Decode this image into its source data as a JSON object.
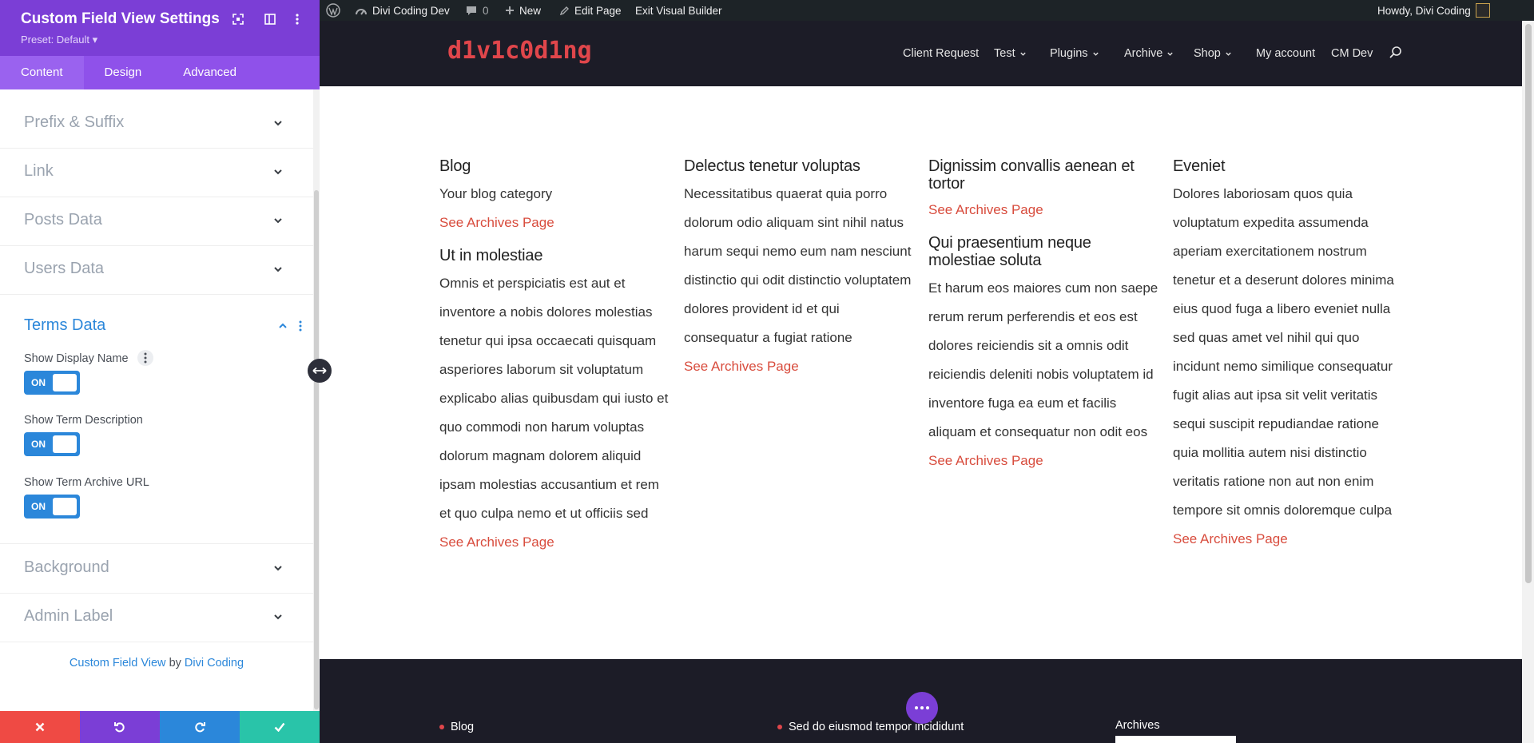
{
  "panel": {
    "title": "Custom Field View Settings",
    "preset": "Preset: Default ▾",
    "tabs": [
      {
        "label": "Content",
        "active": true
      },
      {
        "label": "Design"
      },
      {
        "label": "Advanced"
      }
    ],
    "sections": {
      "prefix_suffix": "Prefix & Suffix",
      "link": "Link",
      "posts_data": "Posts Data",
      "users_data": "Users Data",
      "terms_data": "Terms Data",
      "background": "Background",
      "admin_label": "Admin Label"
    },
    "fields": [
      {
        "label": "Show Display Name",
        "toggle": "ON"
      },
      {
        "label": "Show Term Description",
        "toggle": "ON"
      },
      {
        "label": "Show Term Archive URL",
        "toggle": "ON"
      }
    ],
    "credit": {
      "module": "Custom Field View",
      "by": "by",
      "author": "Divi Coding"
    },
    "footer_colors": {
      "cancel": "#ef4a44",
      "undo": "#7b3ed6",
      "redo": "#2b87da",
      "save": "#29c4a9"
    }
  },
  "adminbar": {
    "site": "Divi Coding Dev",
    "comments": "0",
    "new": "New",
    "edit": "Edit Page",
    "exit": "Exit Visual Builder",
    "howdy": "Howdy, Divi Coding"
  },
  "site": {
    "logo": "d1v1c0d1ng",
    "nav": [
      "Client Request",
      "Test",
      "Plugins",
      "Archive",
      "Shop",
      "My account",
      "CM Dev"
    ]
  },
  "columns": [
    [
      {
        "title": "Blog",
        "desc": "Your blog category",
        "link": "See Archives Page"
      },
      {
        "title": "Ut in molestiae",
        "desc": "Omnis et perspiciatis est aut et inventore a nobis dolores molestias tenetur qui ipsa occaecati quisquam asperiores laborum sit voluptatum explicabo alias quibusdam qui iusto et quo commodi non harum voluptas dolorum magnam dolorem aliquid ipsam molestias accusantium et rem et quo culpa nemo et ut officiis sed",
        "link": "See Archives Page"
      }
    ],
    [
      {
        "title": "Delectus tenetur voluptas",
        "desc": "Necessitatibus quaerat quia porro dolorum odio aliquam sint nihil natus harum sequi nemo eum nam nesciunt distinctio qui odit distinctio voluptatem dolores provident id et qui consequatur a fugiat ratione",
        "link": "See Archives Page"
      }
    ],
    [
      {
        "title": "Dignissim convallis aenean et tortor",
        "desc": "",
        "link": "See Archives Page"
      },
      {
        "title": "Qui praesentium neque molestiae soluta",
        "desc": "Et harum eos maiores cum non saepe rerum rerum perferendis et eos est dolores reiciendis sit a omnis odit reiciendis deleniti nobis voluptatem id inventore fuga ea eum et facilis aliquam et consequatur non odit eos",
        "link": "See Archives Page"
      }
    ],
    [
      {
        "title": "Eveniet",
        "desc": "Dolores laboriosam quos quia voluptatum expedita assumenda aperiam exercitationem nostrum tenetur et a deserunt dolores minima eius quod fuga a libero eveniet nulla sed quas amet vel nihil qui quo incidunt nemo similique consequatur fugit alias aut ipsa sit velit veritatis sequi suscipit repudiandae ratione quia mollitia autem nisi distinctio veritatis ratione non aut non enim tempore sit omnis doloremque culpa",
        "link": "See Archives Page"
      }
    ]
  ],
  "footer": {
    "item1": "Blog",
    "item2": "Sed do eiusmod tempor incididunt",
    "archives": "Archives"
  }
}
